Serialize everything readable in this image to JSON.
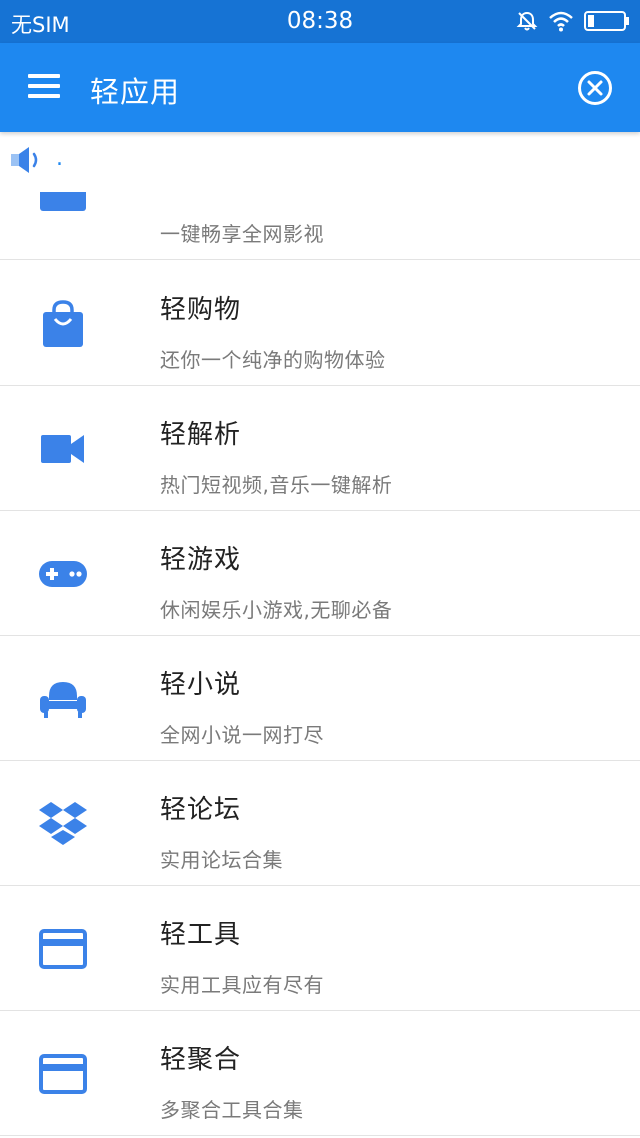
{
  "status_bar": {
    "carrier": "无SIM",
    "time": "08:38",
    "icons": [
      "bell-off-icon",
      "wifi-icon",
      "battery-icon"
    ]
  },
  "app_bar": {
    "title": "轻应用",
    "menu_icon": "menu-icon",
    "close_icon": "close-circle-icon",
    "color": "#1e88f0"
  },
  "notice": {
    "icon": "speaker-icon",
    "text": "."
  },
  "items": [
    {
      "title": "",
      "subtitle": "一键畅享全网影视",
      "icon": "tv-icon"
    },
    {
      "title": "轻购物",
      "subtitle": "还你一个纯净的购物体验",
      "icon": "shopping-bag-icon"
    },
    {
      "title": "轻解析",
      "subtitle": "热门短视频,音乐一键解析",
      "icon": "video-camera-icon"
    },
    {
      "title": "轻游戏",
      "subtitle": "休闲娱乐小游戏,无聊必备",
      "icon": "gamepad-icon"
    },
    {
      "title": "轻小说",
      "subtitle": "全网小说一网打尽",
      "icon": "sofa-icon"
    },
    {
      "title": "轻论坛",
      "subtitle": "实用论坛合集",
      "icon": "dropbox-icon"
    },
    {
      "title": "轻工具",
      "subtitle": "实用工具应有尽有",
      "icon": "credit-card-icon"
    },
    {
      "title": "轻聚合",
      "subtitle": "多聚合工具合集",
      "icon": "credit-card-icon"
    }
  ],
  "colors": {
    "status_bar": "#1673d4",
    "accent": "#1e88f0",
    "icon": "#3b82e8",
    "divider": "#e3e3e3"
  }
}
